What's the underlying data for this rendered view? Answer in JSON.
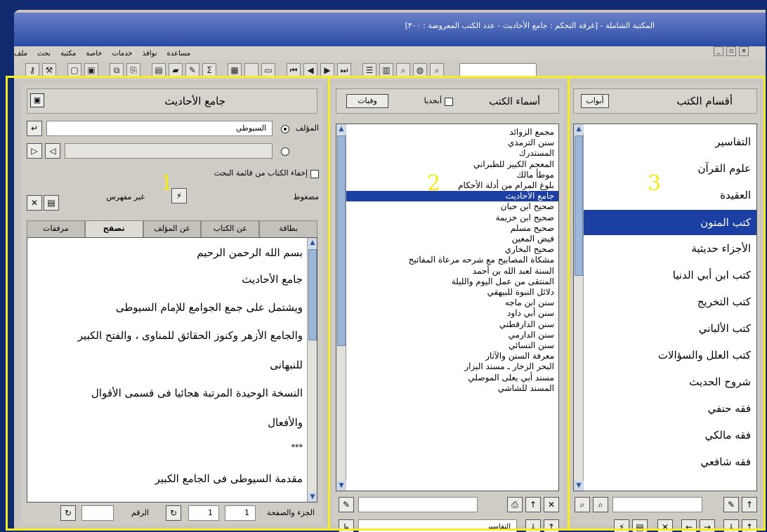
{
  "window": {
    "title": "المكتبة الشاملة - [غرفة التحكم : جامع الأحاديث - عدد الكتب المعروضة : ٣٠٠]",
    "menu": [
      "ملف",
      "بحث",
      "مكتبة",
      "خاصة",
      "خدمات",
      "نوافذ",
      "مساعدة"
    ],
    "controls": [
      "_",
      "▫",
      "×"
    ]
  },
  "panel_numbers": {
    "p1": "1",
    "p2": "2",
    "p3": "3"
  },
  "panel1": {
    "book_title": "جامع الأحاديث",
    "author_label": "المؤلف",
    "author_value": "السيوطي",
    "hide_book_label": "إخفاء الكتاب من قائمة البحث",
    "compressed_label": "مضغوط",
    "index_status": "غير مفهرس",
    "tabs": [
      "بطاقة",
      "عن الكتاب",
      "عن المؤلف",
      "تصفح",
      "مرفقات"
    ],
    "content_lines": [
      "بسم الله الرحمن الرحيم",
      "جامع الأحاديث",
      "ويشتمل على جمع الجوامع للإمام السيوطى",
      "والجامع الأزهر وكنوز الحقائق للمناوى ، والفتح الكبير",
      "للنبهانى",
      "النسخة الوحيدة المرتبة هجائيا فى قسمى الأقوال",
      "والأفعال",
      "***",
      "مقدمة السيوطى فى الجامع الكبير"
    ],
    "footer": {
      "part_page_label": "الجزء والصفحة",
      "part_value": "1",
      "page_value": "1",
      "number_label": "الرقم",
      "number_value": ""
    }
  },
  "panel2": {
    "header_title": "أسماء الكتب",
    "alphabetical_label": "أبجديا",
    "deaths_button": "وفيات",
    "books": [
      "مجمع الزوائد",
      "سنن الترمذي",
      "المستدرك",
      "المعجم الكبير للطبراني",
      "موطأ مالك",
      "بلوغ المرام من أدلة الأحكام",
      "جامع الأحاديث",
      "صحيح ابن حبان",
      "صحيح ابن خزيمة",
      "صحيح مسلم",
      "فيض المعين",
      "صحيح البخاري",
      "مشكاة المصابيح مع شرحه مرعاة المفاتيح",
      "السنة لعبد الله بن أحمد",
      "المنتقى من عمل اليوم والليلة",
      "دلائل النبوة للبيهقي",
      "سنن ابن ماجه",
      "سنن أبي داود",
      "سنن الدارقطني",
      "سنن الدارمي",
      "سنن النسائي",
      "معرفة السنن والآثار",
      "البحر الزخار ـ مسند البزار",
      "مسند أبي يعلى الموصلي",
      "المسند للشاشي"
    ],
    "selected_index": 6,
    "category_dropdown": "التفاسير"
  },
  "panel3": {
    "header_title": "أقسام الكتب",
    "header_button": "أبواب",
    "categories": [
      "التفاسير",
      "علوم القرآن",
      "العقيدة",
      "كتب المتون",
      "الأجزاء حديثية",
      "كتب ابن أبي الدنيا",
      "كتب التخريج",
      "كتب الألباني",
      "كتب العلل والسؤالات",
      "شروح الحديث",
      "فقه حنفي",
      "فقه مالكي",
      "فقه شافعي"
    ],
    "selected_index": 3
  },
  "colors": {
    "frame": "#f6ee25",
    "selection": "#1c3fa3",
    "panel_bg": "#cfccc6"
  }
}
